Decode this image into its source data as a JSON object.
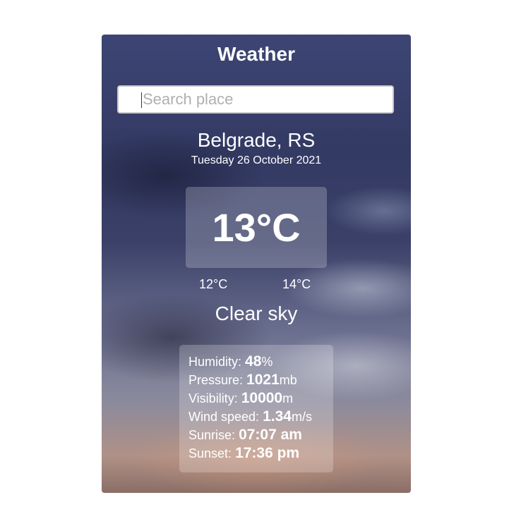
{
  "app": {
    "title": "Weather"
  },
  "search": {
    "placeholder": "Search place",
    "value": ""
  },
  "location": {
    "city": "Belgrade, RS",
    "date": "Tuesday 26 October 2021"
  },
  "temperature": {
    "current": "13°C",
    "min": "12°C",
    "max": "14°C"
  },
  "condition": "Clear sky",
  "details": {
    "humidity": {
      "label": "Humidity:",
      "value": "48",
      "unit": "%"
    },
    "pressure": {
      "label": "Pressure:",
      "value": "1021",
      "unit": "mb"
    },
    "visibility": {
      "label": "Visibility:",
      "value": "10000",
      "unit": "m"
    },
    "wind": {
      "label": "Wind speed:",
      "value": "1.34",
      "unit": "m/s"
    },
    "sunrise": {
      "label": "Sunrise:",
      "value": "07:07 am"
    },
    "sunset": {
      "label": "Sunset:",
      "value": "17:36 pm"
    }
  }
}
